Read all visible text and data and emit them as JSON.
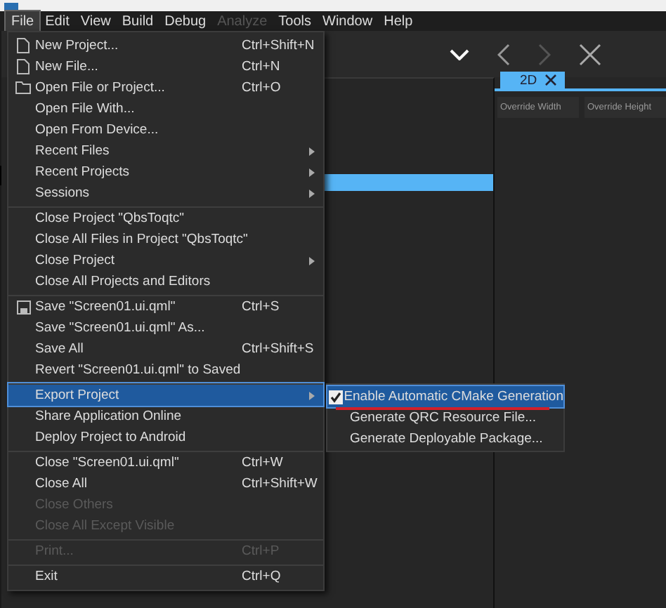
{
  "menubar": [
    {
      "label": "File",
      "selected": true,
      "disabled": false
    },
    {
      "label": "Edit",
      "selected": false,
      "disabled": false
    },
    {
      "label": "View",
      "selected": false,
      "disabled": false
    },
    {
      "label": "Build",
      "selected": false,
      "disabled": false
    },
    {
      "label": "Debug",
      "selected": false,
      "disabled": false
    },
    {
      "label": "Analyze",
      "selected": false,
      "disabled": true
    },
    {
      "label": "Tools",
      "selected": false,
      "disabled": false
    },
    {
      "label": "Window",
      "selected": false,
      "disabled": false
    },
    {
      "label": "Help",
      "selected": false,
      "disabled": false
    }
  ],
  "file_menu": [
    {
      "label": "New Project...",
      "shortcut": "Ctrl+Shift+N",
      "submenu": false,
      "disabled": false,
      "selected": false,
      "separator_before": false
    },
    {
      "label": "New File...",
      "shortcut": "Ctrl+N",
      "submenu": false,
      "disabled": false,
      "selected": false,
      "separator_before": false
    },
    {
      "label": "Open File or Project...",
      "shortcut": "Ctrl+O",
      "submenu": false,
      "disabled": false,
      "selected": false,
      "separator_before": false
    },
    {
      "label": "Open File With...",
      "submenu": false,
      "disabled": false,
      "selected": false,
      "separator_before": false
    },
    {
      "label": "Open From Device...",
      "submenu": false,
      "disabled": false,
      "selected": false,
      "separator_before": false
    },
    {
      "label": "Recent Files",
      "submenu": true,
      "disabled": false,
      "selected": false,
      "separator_before": false
    },
    {
      "label": "Recent Projects",
      "submenu": true,
      "disabled": false,
      "selected": false,
      "separator_before": false
    },
    {
      "label": "Sessions",
      "submenu": true,
      "disabled": false,
      "selected": false,
      "separator_before": false
    },
    {
      "label": "Close Project \"QbsToqtc\"",
      "submenu": false,
      "disabled": false,
      "selected": false,
      "separator_before": true
    },
    {
      "label": "Close All Files in Project \"QbsToqtc\"",
      "submenu": false,
      "disabled": false,
      "selected": false,
      "separator_before": false
    },
    {
      "label": "Close Project",
      "submenu": true,
      "disabled": false,
      "selected": false,
      "separator_before": false
    },
    {
      "label": "Close All Projects and Editors",
      "submenu": false,
      "disabled": false,
      "selected": false,
      "separator_before": false
    },
    {
      "label": "Save \"Screen01.ui.qml\"",
      "shortcut": "Ctrl+S",
      "submenu": false,
      "disabled": false,
      "selected": false,
      "separator_before": true
    },
    {
      "label": "Save \"Screen01.ui.qml\" As...",
      "submenu": false,
      "disabled": false,
      "selected": false,
      "separator_before": false
    },
    {
      "label": "Save All",
      "shortcut": "Ctrl+Shift+S",
      "submenu": false,
      "disabled": false,
      "selected": false,
      "separator_before": false
    },
    {
      "label": "Revert \"Screen01.ui.qml\" to Saved",
      "submenu": false,
      "disabled": false,
      "selected": false,
      "separator_before": false
    },
    {
      "label": "Export Project",
      "submenu": true,
      "disabled": false,
      "selected": true,
      "separator_before": true
    },
    {
      "label": "Share Application Online",
      "submenu": false,
      "disabled": false,
      "selected": false,
      "separator_before": false
    },
    {
      "label": "Deploy Project to Android",
      "submenu": false,
      "disabled": false,
      "selected": false,
      "separator_before": false
    },
    {
      "label": "Close \"Screen01.ui.qml\"",
      "shortcut": "Ctrl+W",
      "submenu": false,
      "disabled": false,
      "selected": false,
      "separator_before": true
    },
    {
      "label": "Close All",
      "shortcut": "Ctrl+Shift+W",
      "submenu": false,
      "disabled": false,
      "selected": false,
      "separator_before": false
    },
    {
      "label": "Close Others",
      "submenu": false,
      "disabled": true,
      "selected": false,
      "separator_before": false
    },
    {
      "label": "Close All Except Visible",
      "submenu": false,
      "disabled": true,
      "selected": false,
      "separator_before": false
    },
    {
      "label": "Print...",
      "shortcut": "Ctrl+P",
      "submenu": false,
      "disabled": true,
      "selected": false,
      "separator_before": true
    },
    {
      "label": "Exit",
      "shortcut": "Ctrl+Q",
      "submenu": false,
      "disabled": false,
      "selected": false,
      "separator_before": true
    }
  ],
  "export_submenu": [
    {
      "label": "Enable Automatic CMake Generation",
      "checked": true,
      "selected": true
    },
    {
      "label": "Generate QRC Resource File...",
      "checked": false,
      "selected": false
    },
    {
      "label": "Generate Deployable Package...",
      "checked": false,
      "selected": false
    }
  ],
  "view_tab": {
    "label": "2D",
    "selected": true
  },
  "columns": [
    "Override Width",
    "Override Height"
  ]
}
